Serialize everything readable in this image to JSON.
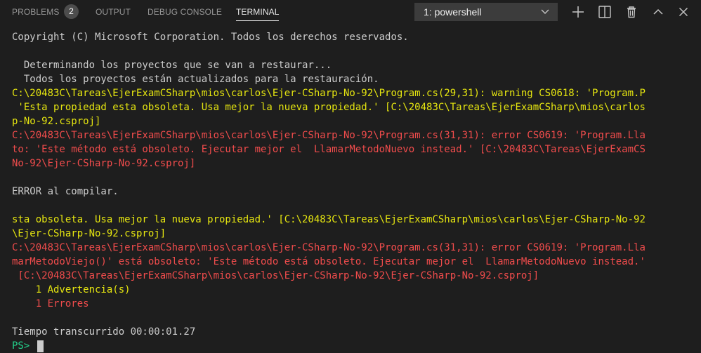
{
  "panel": {
    "tabs": [
      {
        "label": "PROBLEMS",
        "active": false
      },
      {
        "label": "OUTPUT",
        "active": false
      },
      {
        "label": "DEBUG CONSOLE",
        "active": false
      },
      {
        "label": "TERMINAL",
        "active": true
      }
    ],
    "problems_count": "2",
    "terminal_select": {
      "value": "1: powershell"
    },
    "icons": [
      "plus-icon",
      "split-terminal-icon",
      "trash-icon",
      "chevron-up-icon",
      "close-icon"
    ]
  },
  "colors": {
    "background": "#1e1e1e",
    "text": "#cccccc",
    "warning": "#e5e510",
    "error": "#f14c4c",
    "prompt": "#23d18b"
  },
  "terminal": {
    "lines": [
      {
        "text": "Copyright (C) Microsoft Corporation. Todos los derechos reservados.",
        "kind": "normal"
      },
      {
        "text": "",
        "kind": "normal"
      },
      {
        "text": "  Determinando los proyectos que se van a restaurar...",
        "kind": "normal"
      },
      {
        "text": "  Todos los proyectos están actualizados para la restauración.",
        "kind": "normal"
      },
      {
        "text": "C:\\20483C\\Tareas\\EjerExamCSharp\\mios\\carlos\\Ejer-CSharp-No-92\\Program.cs(29,31): warning CS0618: 'Program.P",
        "kind": "warning"
      },
      {
        "text": " 'Esta propiedad esta obsoleta. Usa mejor la nueva propiedad.' [C:\\20483C\\Tareas\\EjerExamCSharp\\mios\\carlos",
        "kind": "warning"
      },
      {
        "text": "p-No-92.csproj]",
        "kind": "warning"
      },
      {
        "text": "C:\\20483C\\Tareas\\EjerExamCSharp\\mios\\carlos\\Ejer-CSharp-No-92\\Program.cs(31,31): error CS0619: 'Program.Lla",
        "kind": "error"
      },
      {
        "text": "to: 'Este método está obsoleto. Ejecutar mejor el  LlamarMetodoNuevo instead.' [C:\\20483C\\Tareas\\EjerExamCS",
        "kind": "error"
      },
      {
        "text": "No-92\\Ejer-CSharp-No-92.csproj]",
        "kind": "error"
      },
      {
        "text": "",
        "kind": "normal"
      },
      {
        "text": "ERROR al compilar.",
        "kind": "normal"
      },
      {
        "text": "",
        "kind": "normal"
      },
      {
        "text": "sta obsoleta. Usa mejor la nueva propiedad.' [C:\\20483C\\Tareas\\EjerExamCSharp\\mios\\carlos\\Ejer-CSharp-No-92",
        "kind": "warning"
      },
      {
        "text": "\\Ejer-CSharp-No-92.csproj]",
        "kind": "warning"
      },
      {
        "text": "C:\\20483C\\Tareas\\EjerExamCSharp\\mios\\carlos\\Ejer-CSharp-No-92\\Program.cs(31,31): error CS0619: 'Program.Lla",
        "kind": "error"
      },
      {
        "text": "marMetodoViejo()' está obsoleto: 'Este método está obsoleto. Ejecutar mejor el  LlamarMetodoNuevo instead.'",
        "kind": "error"
      },
      {
        "text": " [C:\\20483C\\Tareas\\EjerExamCSharp\\mios\\carlos\\Ejer-CSharp-No-92\\Ejer-CSharp-No-92.csproj]",
        "kind": "error"
      },
      {
        "text": "    1 Advertencia(s)",
        "kind": "warning"
      },
      {
        "text": "    1 Errores",
        "kind": "error"
      },
      {
        "text": "",
        "kind": "normal"
      },
      {
        "text": "Tiempo transcurrido 00:00:01.27",
        "kind": "normal"
      },
      {
        "text": "PS> ",
        "kind": "prompt"
      }
    ]
  }
}
